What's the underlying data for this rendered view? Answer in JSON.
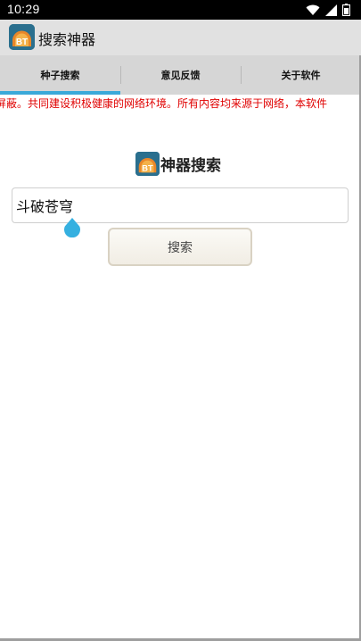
{
  "status_bar": {
    "time": "10:29",
    "icons": [
      "wifi-icon",
      "cellular-signal-icon",
      "battery-icon"
    ]
  },
  "app_bar": {
    "title": "搜索神器",
    "logo_text": "BT",
    "background": "#e1e1e1"
  },
  "tabs": [
    {
      "label": "种子搜索",
      "selected": true
    },
    {
      "label": "意见反馈",
      "selected": false
    },
    {
      "label": "关于软件",
      "selected": false
    }
  ],
  "notice": {
    "text": "屏蔽。共同建设积极健康的网络环境。所有内容均来源于网络，本软件",
    "color": "#e00000"
  },
  "search": {
    "heading": "神器搜索",
    "logo_text": "BT",
    "input_value": "斗破苍穹",
    "button_label": "搜索"
  },
  "colors": {
    "accent": "#3aa9d9",
    "tab_bar": "#d6d6d6",
    "status_bar": "#000000"
  }
}
